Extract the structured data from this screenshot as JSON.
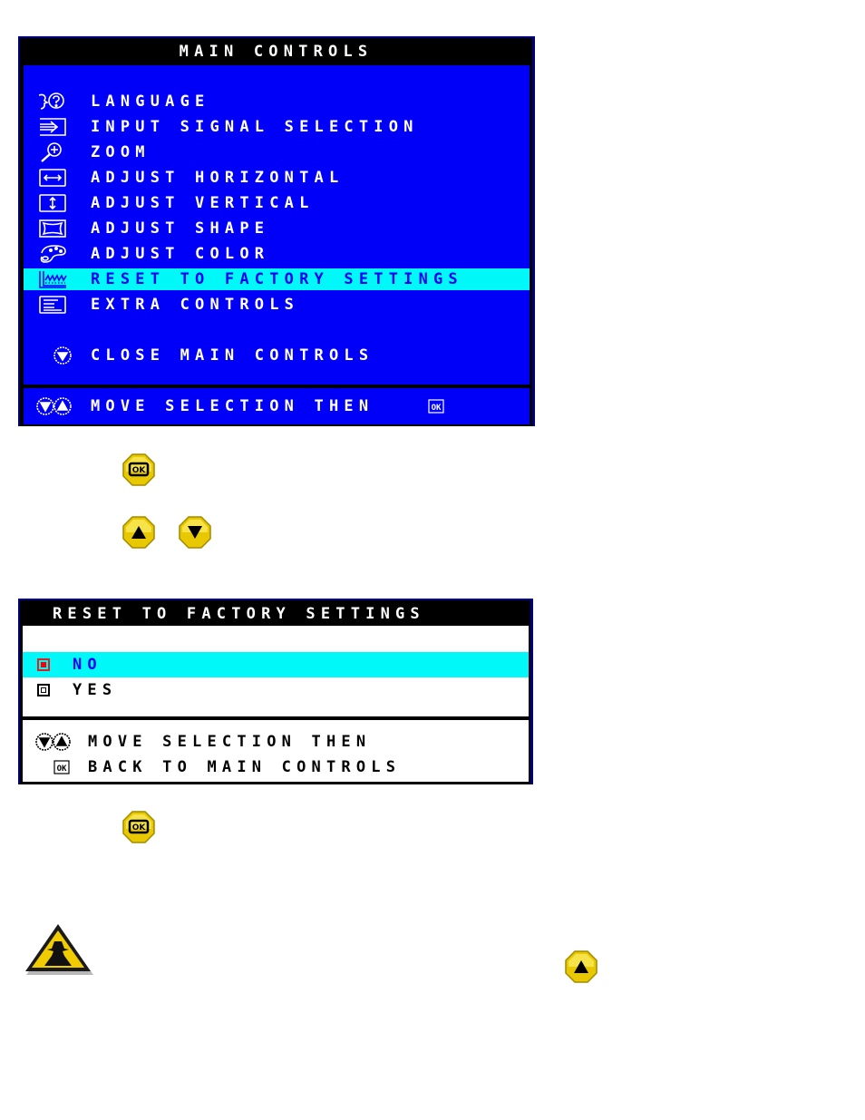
{
  "main_controls": {
    "title": "MAIN CONTROLS",
    "items": [
      {
        "icon": "language-icon",
        "label": "LANGUAGE",
        "selected": false
      },
      {
        "icon": "input-signal-icon",
        "label": "INPUT SIGNAL SELECTION",
        "selected": false
      },
      {
        "icon": "zoom-icon",
        "label": "ZOOM",
        "selected": false
      },
      {
        "icon": "horizontal-arrows-icon",
        "label": "ADJUST HORIZONTAL",
        "selected": false
      },
      {
        "icon": "vertical-arrows-icon",
        "label": "ADJUST VERTICAL",
        "selected": false
      },
      {
        "icon": "shape-icon",
        "label": "ADJUST SHAPE",
        "selected": false
      },
      {
        "icon": "palette-icon",
        "label": "ADJUST COLOR",
        "selected": false
      },
      {
        "icon": "factory-icon",
        "label": "RESET TO FACTORY SETTINGS",
        "selected": true
      },
      {
        "icon": "extra-controls-icon",
        "label": "EXTRA CONTROLS",
        "selected": false
      }
    ],
    "close_label": "CLOSE MAIN CONTROLS",
    "footer": "MOVE SELECTION THEN"
  },
  "step_buttons": {
    "ok": "ok-button-icon",
    "up": "up-button-icon",
    "down": "down-button-icon"
  },
  "reset_panel": {
    "title": "RESET TO FACTORY SETTINGS",
    "options": [
      {
        "label": "NO",
        "selected": true
      },
      {
        "label": "YES",
        "selected": false
      }
    ],
    "footer_line1": "MOVE SELECTION THEN",
    "footer_line2": "BACK TO MAIN CONTROLS"
  },
  "colors": {
    "osd_blue": "#0000f8",
    "highlight_cyan": "#00f8f8",
    "button_yellow": "#f0d800",
    "selected_marker_red": "#f80000"
  }
}
